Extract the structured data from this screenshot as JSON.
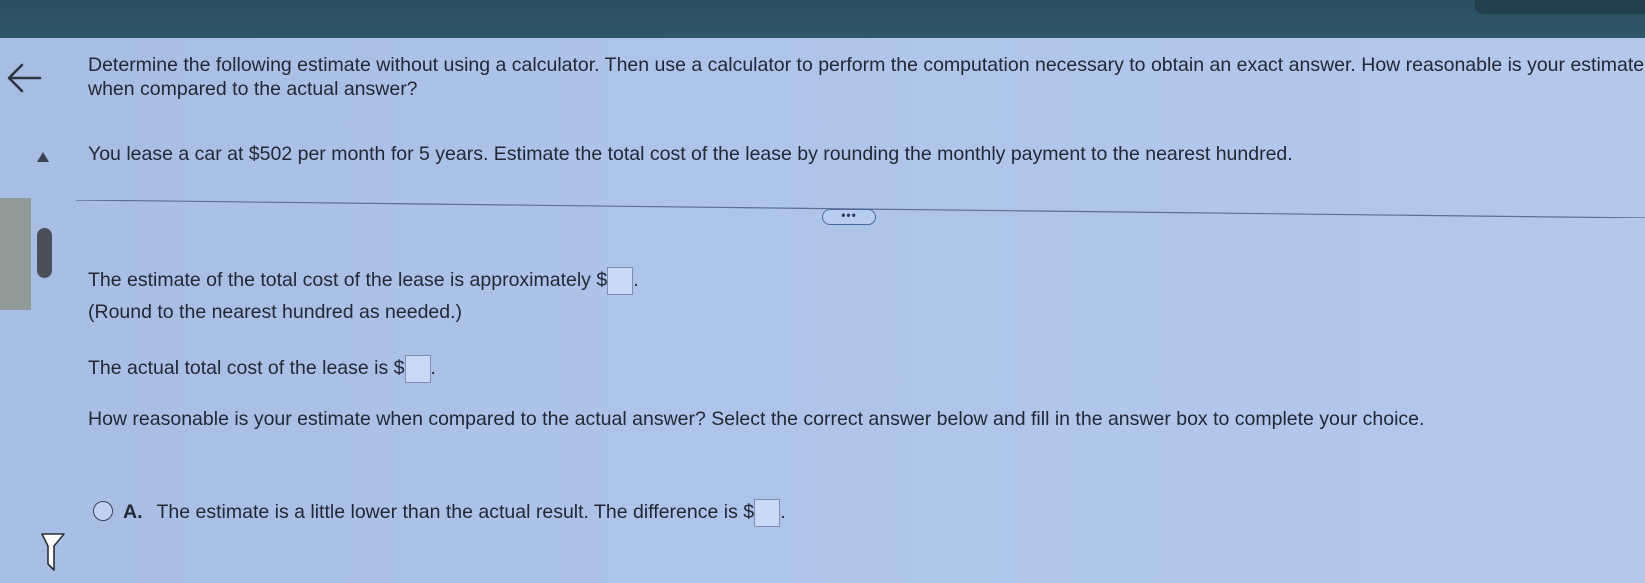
{
  "question": {
    "instruction": "Determine the following estimate without using a calculator. Then use a calculator to perform the computation necessary to obtain an exact answer. How reasonable is your estimate when compared to the actual answer?",
    "problem": "You lease a car at $502 per month for 5 years. Estimate the total cost of the lease by rounding the monthly payment to the nearest hundred."
  },
  "expand_button_label": "•••",
  "parts": {
    "estimate_label": "The estimate of the total cost of the lease is approximately $",
    "estimate_value": "",
    "estimate_note": "(Round to the nearest hundred as needed.)",
    "actual_label": "The actual total cost of the lease is $",
    "actual_value": "",
    "reasonable_prompt": "How reasonable is your estimate when compared to the actual answer? Select the correct answer below and fill in the answer box to complete your choice."
  },
  "options": [
    {
      "letter": "A.",
      "text": "The estimate is a little lower than the actual result. The difference is $",
      "value": ""
    }
  ],
  "icons": {
    "back": "left-arrow-icon",
    "scroll_up": "triangle-up-icon",
    "cursor": "mouse-cursor-icon"
  }
}
